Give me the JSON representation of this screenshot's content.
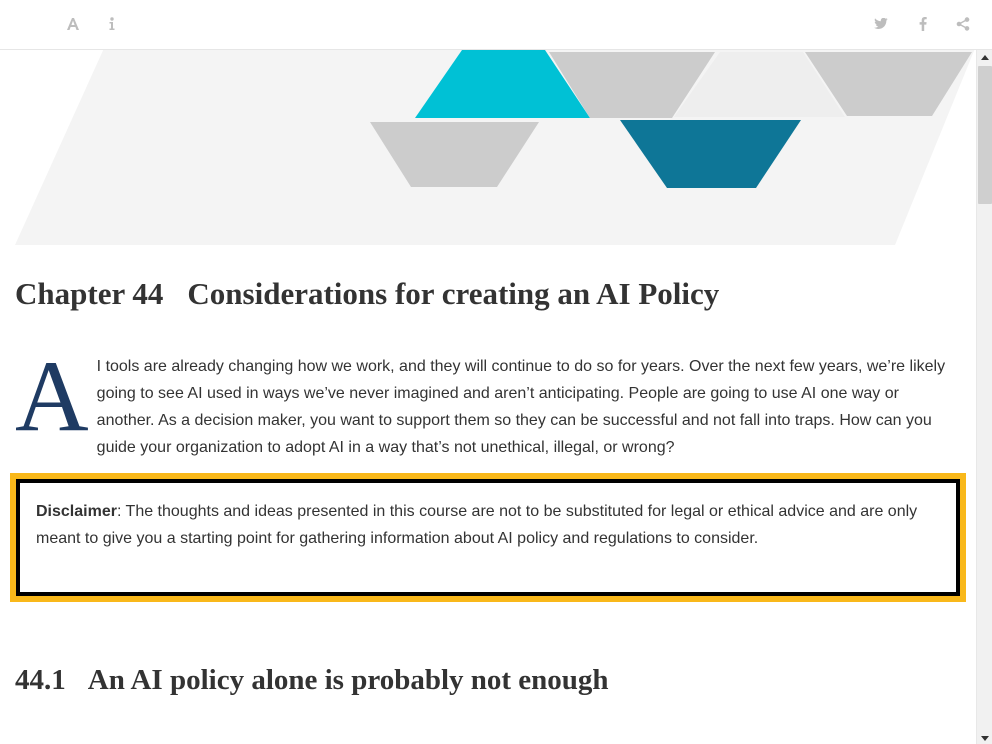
{
  "toolbar": {
    "left_icons": [
      "font-settings-icon",
      "info-icon"
    ],
    "right_icons": [
      "twitter-icon",
      "facebook-icon",
      "share-icon"
    ]
  },
  "colors": {
    "icon_gray": "#bdbdbd",
    "banner_cyan": "#00c1d5",
    "banner_teal": "#0e7697",
    "banner_gray": "#cccccc",
    "dropcap_navy": "#1f3b63",
    "disclaimer_border": "#f9b81a"
  },
  "chapter": {
    "number": "Chapter 44",
    "title": "Considerations for creating an AI Policy"
  },
  "intro": {
    "dropcap": "A",
    "text": "I tools are already changing how we work, and they will continue to do so for years. Over the next few years, we’re likely going to see AI used in ways we’ve never imagined and aren’t anticipating. People are going to use AI one way or another. As a decision maker, you want to support them so they can be successful and not fall into traps. How can you guide your organization to adopt AI in a way that’s not unethical, illegal, or wrong?"
  },
  "disclaimer": {
    "label": "Disclaimer",
    "text": ": The thoughts and ideas presented in this course are not to be substituted for legal or ethical advice and are only meant to give you a starting point for gathering information about AI policy and regulations to consider."
  },
  "section": {
    "number": "44.1",
    "title": "An AI policy alone is probably not enough"
  }
}
